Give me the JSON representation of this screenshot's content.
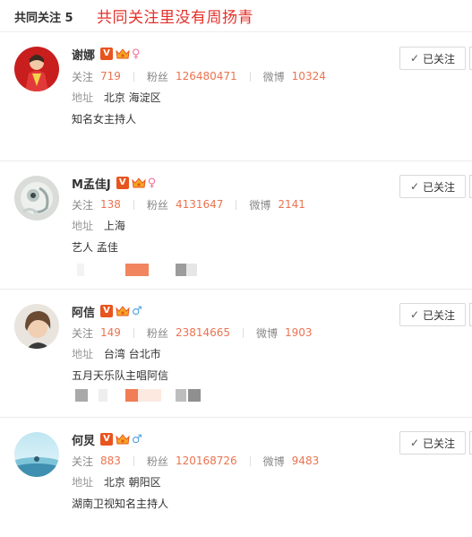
{
  "header": {
    "title": "共同关注 5",
    "annotation": "共同关注里没有周扬青"
  },
  "labels": {
    "follow": "关注",
    "fans": "粉丝",
    "weibo": "微博",
    "location": "地址",
    "followed_button": "已关注"
  },
  "colors": {
    "stat_value": "#eb7350",
    "annotation": "#e4312b",
    "verified_badge": "#e8541e",
    "female": "#f3709a",
    "male": "#4c9fe2"
  },
  "users": [
    {
      "name": "谢娜",
      "verified": "V",
      "gender_icon": "female-icon",
      "gender_symbol": "♀",
      "follow": "719",
      "fans": "126480471",
      "weibo": "10324",
      "location": "北京 海淀区",
      "bio": "知名女主持人"
    },
    {
      "name": "M孟佳J",
      "verified": "V",
      "gender_icon": "female-icon",
      "gender_symbol": "♀",
      "follow": "138",
      "fans": "4131647",
      "weibo": "2141",
      "location": "上海",
      "bio": "艺人 孟佳"
    },
    {
      "name": "阿信",
      "verified": "V",
      "gender_icon": "male-icon",
      "gender_symbol": "♂",
      "follow": "149",
      "fans": "23814665",
      "weibo": "1903",
      "location": "台湾 台北市",
      "bio": "五月天乐队主唱阿信"
    },
    {
      "name": "何炅",
      "verified": "V",
      "gender_icon": "male-icon",
      "gender_symbol": "♂",
      "follow": "883",
      "fans": "120168726",
      "weibo": "9483",
      "location": "北京 朝阳区",
      "bio": "湖南卫视知名主持人"
    }
  ]
}
